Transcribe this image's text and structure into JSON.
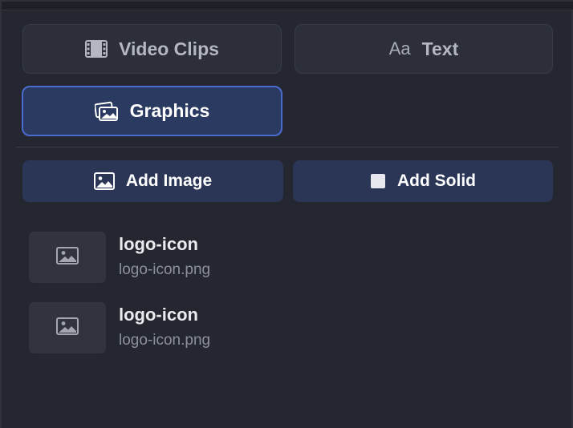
{
  "tabs": {
    "video_clips": {
      "label": "Video Clips",
      "icon": "film-icon"
    },
    "text": {
      "label": "Text",
      "icon_glyph": "Aa",
      "icon": "text-icon"
    },
    "graphics": {
      "label": "Graphics",
      "icon": "images-icon",
      "active": true
    }
  },
  "actions": {
    "add_image": {
      "label": "Add Image",
      "icon": "image-icon"
    },
    "add_solid": {
      "label": "Add Solid",
      "icon": "square-icon"
    }
  },
  "assets": [
    {
      "name": "logo-icon",
      "file": "logo-icon.png",
      "icon": "image-placeholder-icon"
    },
    {
      "name": "logo-icon",
      "file": "logo-icon.png",
      "icon": "image-placeholder-icon"
    }
  ],
  "colors": {
    "background": "#24272f",
    "tab_inactive": "#2c2f37",
    "tab_active": "#2b3a61",
    "tab_active_border": "#4a6bd0",
    "action_button": "#2b3657"
  }
}
